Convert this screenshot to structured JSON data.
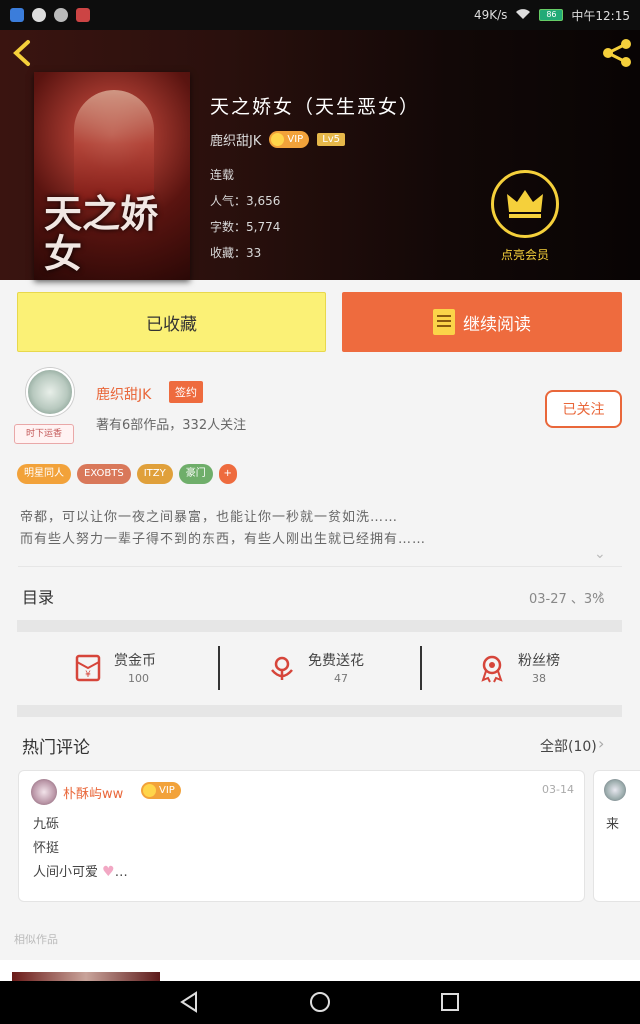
{
  "status_bar": {
    "speed": "49K/s",
    "battery": "86",
    "time": "中午12:15"
  },
  "book": {
    "title": "天之娇女（天生恶女）",
    "cover_text": "天之娇女",
    "author": "鹿织甜JK",
    "vip_label": "VIP",
    "level_label": "Lv5",
    "status": "连载",
    "popularity": "人气：3,656",
    "word_count": "字数：5,774",
    "collections": "收藏：33"
  },
  "membership": {
    "label": "点亮会员"
  },
  "actions": {
    "collected_label": "已收藏",
    "read_label": "继续阅读"
  },
  "author_card": {
    "avatar_tag": "时下运香",
    "name": "鹿织甜JK",
    "sign_badge": "签约",
    "subtitle": "著有6部作品，332人关注",
    "follow_label": "已关注"
  },
  "tags": [
    {
      "label": "明星同人",
      "color": "#f2a23a"
    },
    {
      "label": "EXOBTS",
      "color": "#d9785a"
    },
    {
      "label": "ITZY",
      "color": "#e0a03a"
    },
    {
      "label": "豪门",
      "color": "#6fae6a"
    },
    {
      "label": "+",
      "color": "#ee6b3e"
    }
  ],
  "description": {
    "line1": "帝都，可以让你一夜之间暴富，也能让你一秒就一贫如洗……",
    "line2": "而有些人努力一辈子得不到的东西，有些人刚出生就已经拥有……"
  },
  "toc": {
    "label": "目录",
    "progress": "03-27 、3%"
  },
  "stats": [
    {
      "label": "赏金币",
      "value": "100",
      "icon": "red-envelope-icon"
    },
    {
      "label": "免费送花",
      "value": "47",
      "icon": "flower-icon"
    },
    {
      "label": "粉丝榜",
      "value": "38",
      "icon": "medal-icon"
    }
  ],
  "hot_comments": {
    "label": "热门评论",
    "all_label": "全部(10)",
    "comment": {
      "user": "朴酥屿ww",
      "vip": "VIP",
      "date": "03-14",
      "lines": [
        "九砾",
        "怀挺",
        "人间小可爱"
      ]
    },
    "peek_text": "来"
  },
  "similar": {
    "label": "相似作品"
  },
  "colors": {
    "accent": "#ee6b3e",
    "gold": "#f5d03b",
    "yellow_button": "#fbf176"
  }
}
